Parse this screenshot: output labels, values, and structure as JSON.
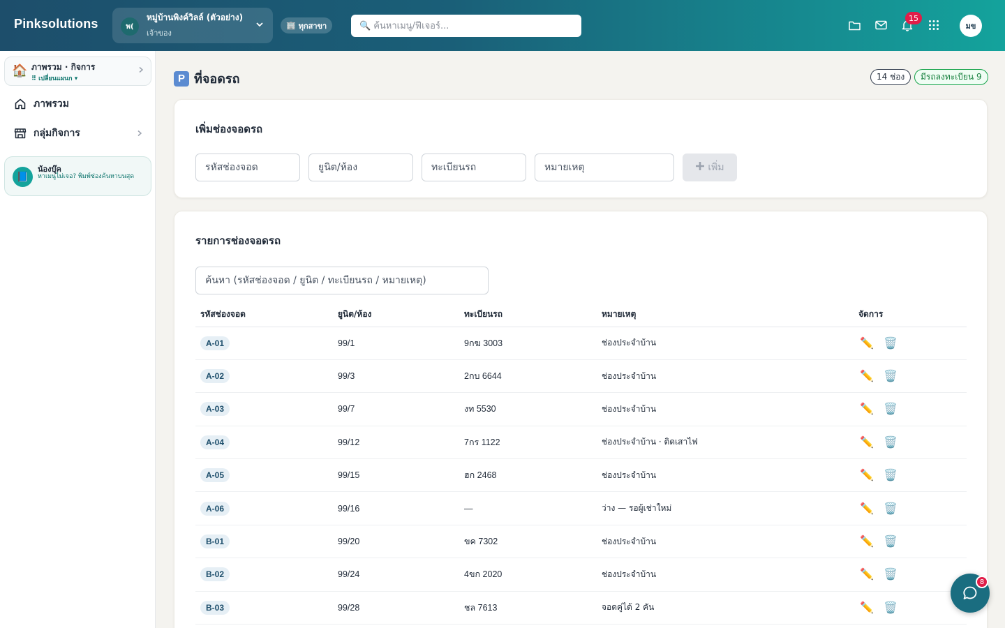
{
  "app": {
    "brand": "Pinksolutions",
    "org_avatar": "พ(",
    "org_name": "หมู่บ้านพิงค์วิลล์ (ตัวอย่าง)",
    "org_role": "เจ้าของ",
    "branch_label": "ทุกสาขา",
    "search_placeholder": "ค้นหาเมนู/ฟีเจอร์...",
    "notif_count": "15",
    "user_initials": "มข"
  },
  "sidebar": {
    "overview_title": "ภาพรวม · กิจการ",
    "overview_sub": "⠿ เปลี่ยนแผนก ▾",
    "items": [
      {
        "label": "ภาพรวม",
        "icon": "home-icon"
      },
      {
        "label": "กลุ่มกิจการ",
        "icon": "store-icon"
      }
    ],
    "helper_title": "น้องบุ๊ค",
    "helper_text": "หาเมนูไม่เจอ? พิมพ์ช่องค้นหาบนสุด"
  },
  "page": {
    "title_icon": "P",
    "title": "ที่จอดรถ",
    "chip_slots": "14 ช่อง",
    "chip_plates": "มีรถลงทะเบียน 9"
  },
  "add_form": {
    "title": "เพิ่มช่องจอดรถ",
    "code_placeholder": "รหัสช่องจอด",
    "unit_placeholder": "ยูนิต/ห้อง",
    "plate_placeholder": "ทะเบียนรถ",
    "note_placeholder": "หมายเหตุ",
    "add_label": "เพิ่ม"
  },
  "list": {
    "title": "รายการช่องจอดรถ",
    "search_placeholder": "ค้นหา (รหัสช่องจอด / ยูนิต / ทะเบียนรถ / หมายเหตุ)",
    "columns": {
      "code": "รหัสช่องจอด",
      "unit": "ยูนิต/ห้อง",
      "plate": "ทะเบียนรถ",
      "note": "หมายเหตุ",
      "actions": "จัดการ"
    },
    "rows": [
      {
        "code": "A-01",
        "unit": "99/1",
        "plate": "9กฆ 3003",
        "note": "ช่องประจำบ้าน"
      },
      {
        "code": "A-02",
        "unit": "99/3",
        "plate": "2กบ 6644",
        "note": "ช่องประจำบ้าน"
      },
      {
        "code": "A-03",
        "unit": "99/7",
        "plate": "งท 5530",
        "note": "ช่องประจำบ้าน"
      },
      {
        "code": "A-04",
        "unit": "99/12",
        "plate": "7กร 1122",
        "note": "ช่องประจำบ้าน · ติดเสาไฟ"
      },
      {
        "code": "A-05",
        "unit": "99/15",
        "plate": "ฮก 2468",
        "note": "ช่องประจำบ้าน"
      },
      {
        "code": "A-06",
        "unit": "99/16",
        "plate": "—",
        "note": "ว่าง — รอผู้เช่าใหม่"
      },
      {
        "code": "B-01",
        "unit": "99/20",
        "plate": "ขค 7302",
        "note": "ช่องประจำบ้าน"
      },
      {
        "code": "B-02",
        "unit": "99/24",
        "plate": "4ขก 2020",
        "note": "ช่องประจำบ้าน"
      },
      {
        "code": "B-03",
        "unit": "99/28",
        "plate": "ชล 7613",
        "note": "จอดคู่ได้ 2 คัน"
      }
    ]
  },
  "chat": {
    "badge": "8"
  }
}
